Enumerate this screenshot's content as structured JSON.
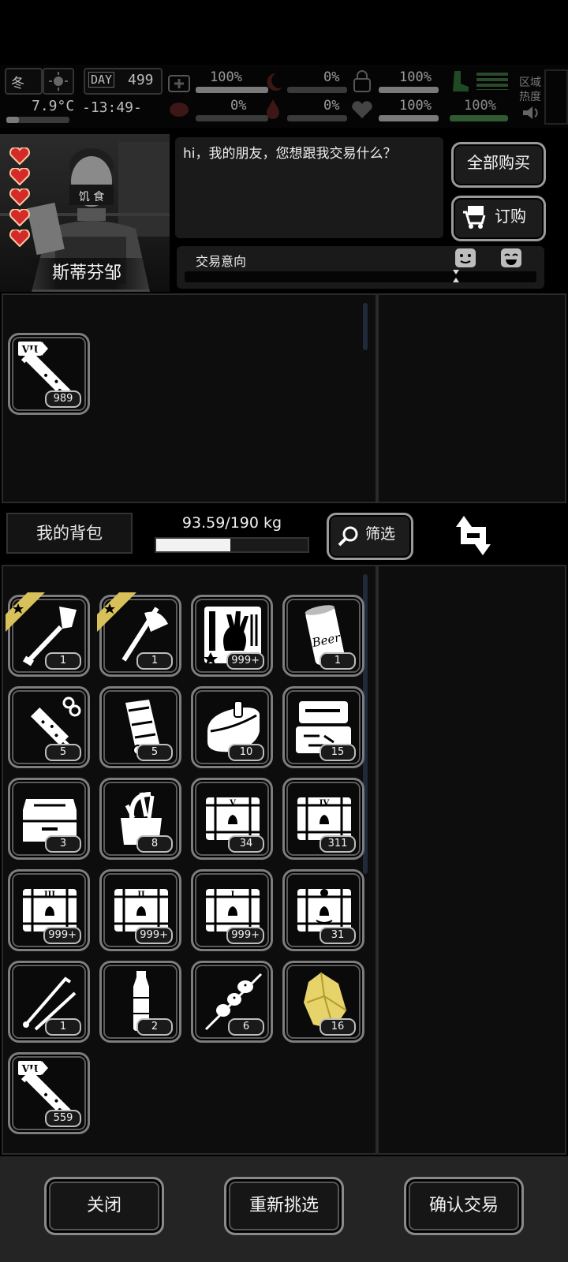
{
  "hud": {
    "season": "冬",
    "day_label": "DAY",
    "day": "499",
    "temperature": "7.9°C",
    "clock": "-13:49-",
    "stats_row1": [
      "100%",
      "0%",
      "100%"
    ],
    "stats_row2": [
      "0%",
      "0%",
      "100%",
      "100%"
    ],
    "region_label_1": "区域",
    "region_label_2": "热度"
  },
  "trader": {
    "name": "斯蒂芬邹",
    "hearts": 5,
    "greeting": "hi，我的朋友，您想跟我交易什么？",
    "buy_all_label": "全部购买",
    "order_label": "订购",
    "intent_label": "交易意向",
    "mask_text": "饥 食"
  },
  "trader_items": [
    {
      "icon": "vial-vii-icon",
      "tier": "VII",
      "count": "989"
    }
  ],
  "backpack": {
    "title": "我的背包",
    "weight": "93.59/190 kg",
    "weight_fraction": 0.49,
    "filter_label": "筛选"
  },
  "backpack_items": [
    {
      "icon": "shovel-icon",
      "count": "1",
      "starred": true
    },
    {
      "icon": "axe-icon",
      "count": "1",
      "starred": true
    },
    {
      "icon": "zombie-hand-card-icon",
      "count": "999+",
      "starred": false
    },
    {
      "icon": "beer-can-icon",
      "count": "1",
      "starred": false
    },
    {
      "icon": "syringe-icon",
      "count": "5",
      "starred": false
    },
    {
      "icon": "scroll-paper-icon",
      "count": "5",
      "starred": false
    },
    {
      "icon": "canned-food-icon",
      "count": "10",
      "starred": false
    },
    {
      "icon": "tool-case-icon",
      "count": "15",
      "starred": false
    },
    {
      "icon": "toolbox-icon",
      "count": "3",
      "starred": false
    },
    {
      "icon": "tool-bag-icon",
      "count": "8",
      "starred": false
    },
    {
      "icon": "crate-v-icon",
      "count": "34",
      "starred": false
    },
    {
      "icon": "crate-iv-icon",
      "count": "311",
      "starred": false
    },
    {
      "icon": "crate-iii-icon",
      "count": "999+",
      "starred": false
    },
    {
      "icon": "crate-ii-icon",
      "count": "999+",
      "starred": false
    },
    {
      "icon": "crate-i-icon",
      "count": "999+",
      "starred": false
    },
    {
      "icon": "crate-special-icon",
      "count": "31",
      "starred": false
    },
    {
      "icon": "lockpick-icon",
      "count": "1",
      "starred": false
    },
    {
      "icon": "water-bottle-icon",
      "count": "2",
      "starred": false
    },
    {
      "icon": "skewer-icon",
      "count": "6",
      "starred": false
    },
    {
      "icon": "gold-ore-icon",
      "count": "16",
      "starred": false
    },
    {
      "icon": "vial-vii-icon",
      "tier": "VII",
      "count": "559",
      "starred": false
    }
  ],
  "footer": {
    "close_label": "关闭",
    "reselect_label": "重新挑选",
    "confirm_label": "确认交易"
  },
  "colors": {
    "background": "#000000",
    "panel": "#0d0d0d",
    "slot_border": "#7d7d7d",
    "gold": "#d8c15a"
  }
}
